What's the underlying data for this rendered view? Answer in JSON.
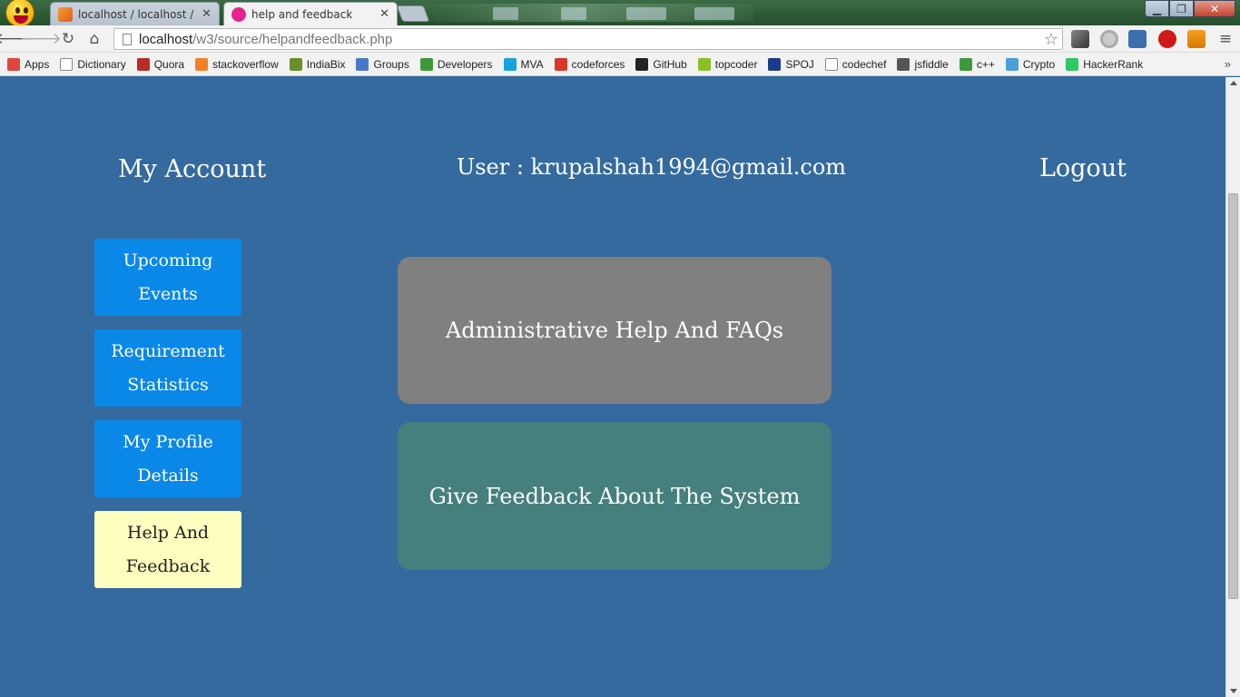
{
  "browser": {
    "tabs": [
      {
        "label": "localhost / localhost / rec",
        "favicon": "phpmyadmin-icon",
        "active": false
      },
      {
        "label": "help and feedback",
        "favicon": "w3-icon",
        "active": true
      }
    ],
    "address": {
      "host": "localhost",
      "path": "/w3/source/helpandfeedback.php"
    },
    "bookmarks": [
      {
        "label": "Apps",
        "icon": "apps-grid-icon",
        "color": "#e0463b"
      },
      {
        "label": "Dictionary",
        "icon": "page-icon",
        "color": "#ffffff"
      },
      {
        "label": "Quora",
        "icon": "quora-icon",
        "color": "#b92b27"
      },
      {
        "label": "stackoverflow",
        "icon": "stackoverflow-icon",
        "color": "#f48024"
      },
      {
        "label": "IndiaBix",
        "icon": "indiabix-icon",
        "color": "#6a8f2a"
      },
      {
        "label": "Groups",
        "icon": "groups-icon",
        "color": "#4a78c9"
      },
      {
        "label": "Developers",
        "icon": "developers-icon",
        "color": "#3c9a3c"
      },
      {
        "label": "MVA",
        "icon": "mva-icon",
        "color": "#17a3db"
      },
      {
        "label": "codeforces",
        "icon": "codeforces-icon",
        "color": "#d9382b"
      },
      {
        "label": "GitHub",
        "icon": "github-icon",
        "color": "#222222"
      },
      {
        "label": "topcoder",
        "icon": "topcoder-icon",
        "color": "#8cbf26"
      },
      {
        "label": "SPOJ",
        "icon": "spoj-icon",
        "color": "#1b3a8a"
      },
      {
        "label": "codechef",
        "icon": "page-icon",
        "color": "#ffffff"
      },
      {
        "label": "jsfiddle",
        "icon": "jsfiddle-icon",
        "color": "#555555"
      },
      {
        "label": "c++",
        "icon": "developers-icon",
        "color": "#3c9a3c"
      },
      {
        "label": "Crypto",
        "icon": "crypto-icon",
        "color": "#4a9fd8"
      },
      {
        "label": "HackerRank",
        "icon": "hackerrank-icon",
        "color": "#2ec866"
      }
    ]
  },
  "page": {
    "my_account": "My Account",
    "user_label": "User : krupalshah1994@gmail.com",
    "logout": "Logout",
    "sidebar": [
      {
        "line1": "Upcoming",
        "line2": "Events",
        "active": false
      },
      {
        "line1": "Requirement",
        "line2": "Statistics",
        "active": false
      },
      {
        "line1": "My Profile",
        "line2": "Details",
        "active": false
      },
      {
        "line1": "Help And",
        "line2": "Feedback",
        "active": true
      }
    ],
    "panels": {
      "help": "Administrative Help And FAQs",
      "feedback": "Give Feedback About The System"
    }
  },
  "colors": {
    "page_bg": "#356a9f",
    "sidebar_btn": "#0a88e8",
    "sidebar_active": "#ffffc0",
    "help_panel": "#808080",
    "feedback_panel": "#457f7e"
  }
}
